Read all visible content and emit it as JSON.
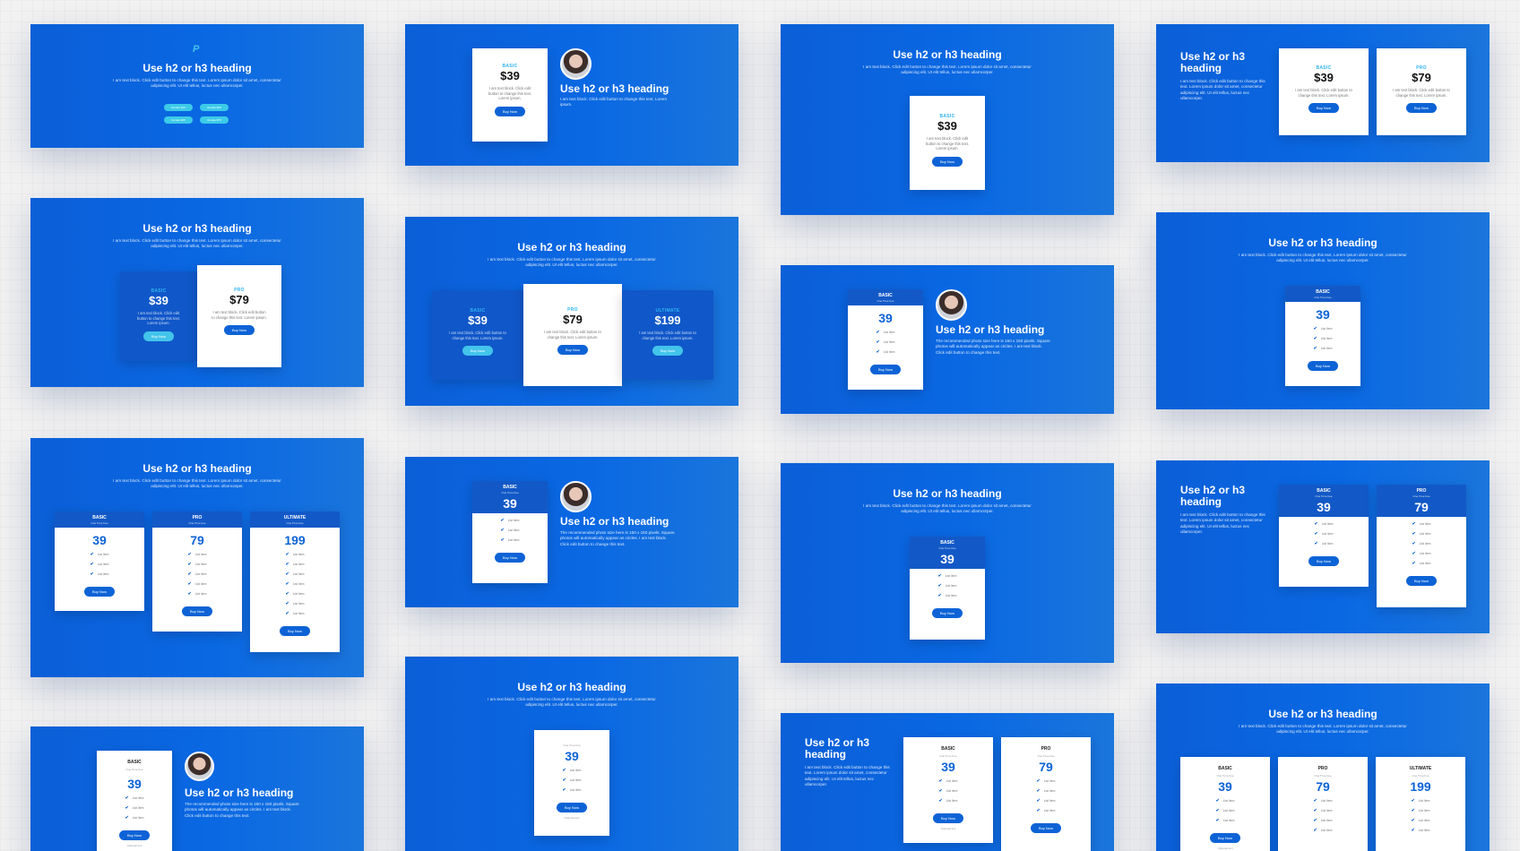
{
  "colors": {
    "panel_blue": "#0a68e3",
    "accent_cyan": "#30b3f0",
    "page_bg": "#f2f2f2",
    "button_blue": "#0d63d6"
  },
  "common": {
    "heading": "Use h2 or h3 heading",
    "heading_two_line": "Use h2 or h3\nheading",
    "lorem": "I am text block. Click edit button to change this text. Lorem ipsum dolor sit amet, consectetur adipiscing elit. Ut elit tellus, luctus nec ullamcorper.",
    "card_text": "I am text block. Click edit button to change this text. Lorem ipsum.",
    "photo_text": "The recommended photo size here is 150 x 150 pixels. Square photos will automatically appear as circles. I am text block. Click edit button to change this text.",
    "buy_now": "Buy Now",
    "one_time_fee": "One Time Fee",
    "list_item": "List Item",
    "optional_text": "Optional text"
  },
  "paypal_buttons": [
    "Donate $10",
    "Donate $20",
    "Donate $25",
    "Donate $75"
  ],
  "tiers": {
    "basic": {
      "name": "BASIC",
      "price": "$39",
      "super": "39"
    },
    "pro": {
      "name": "PRO",
      "price": "$79",
      "super": "79"
    },
    "ultimate": {
      "name": "ULTIMATE",
      "price": "$199",
      "super": "199"
    }
  }
}
